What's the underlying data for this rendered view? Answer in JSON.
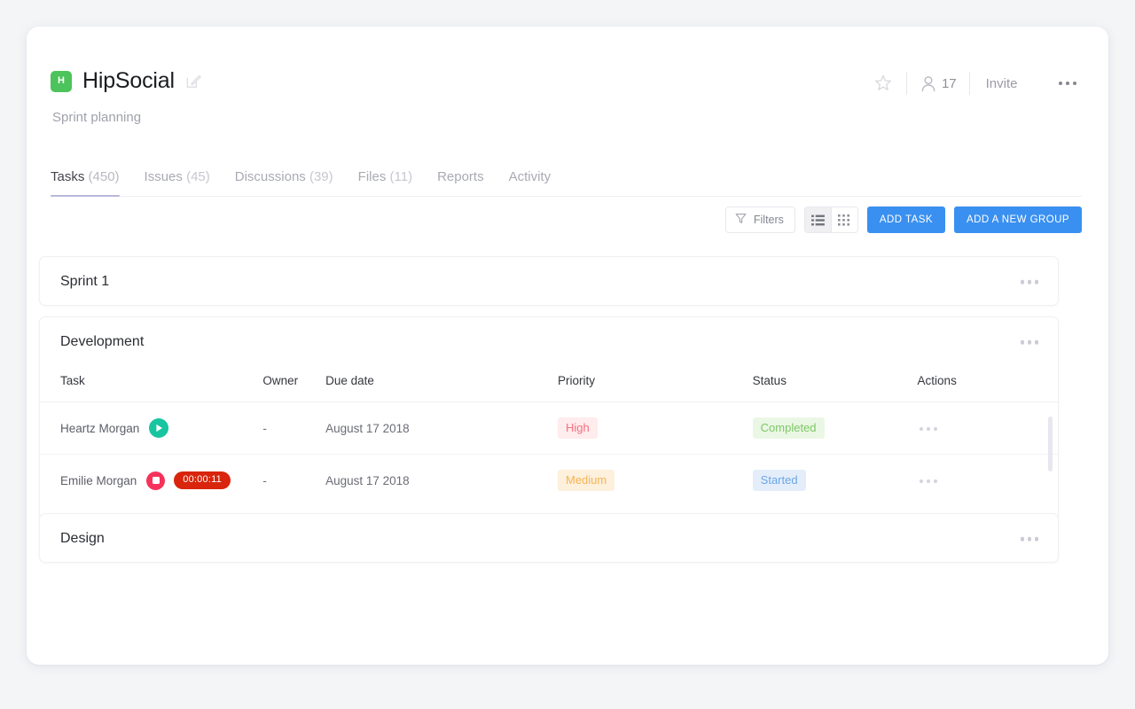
{
  "project": {
    "badge_letter": "H",
    "badge_color": "#4cc35b",
    "title": "HipSocial",
    "subtitle": "Sprint planning",
    "edit_icon": "edit-pencil-icon"
  },
  "header_actions": {
    "favorite_icon": "star-icon",
    "members_icon": "person-icon",
    "members_count": "17",
    "invite_label": "Invite",
    "overflow_icon": "more-horizontal-icon"
  },
  "tabs": [
    {
      "label": "Tasks",
      "count": "(450)",
      "active": true
    },
    {
      "label": "Issues",
      "count": "(45)",
      "active": false
    },
    {
      "label": "Discussions",
      "count": "(39)",
      "active": false
    },
    {
      "label": "Files",
      "count": "(11)",
      "active": false
    },
    {
      "label": "Reports",
      "count": "",
      "active": false
    },
    {
      "label": "Activity",
      "count": "",
      "active": false
    }
  ],
  "toolbar": {
    "filters_label": "Filters",
    "filters_icon": "funnel-icon",
    "list_view_icon": "list-view-icon",
    "grid_view_icon": "grid-view-icon",
    "active_view": "list",
    "add_task_label": "ADD TASK",
    "add_group_label": "ADD A NEW GROUP",
    "primary_color": "#3a90f0"
  },
  "groups": [
    {
      "title": "Sprint 1"
    },
    {
      "title": "Development"
    },
    {
      "title": "Design"
    }
  ],
  "table": {
    "columns": [
      "Task",
      "Owner",
      "Due date",
      "Priority",
      "Status",
      "Actions"
    ],
    "rows": [
      {
        "task": "Heartz Morgan",
        "timer_state": "play",
        "timer_value": "",
        "owner": "-",
        "due_date": "August 17 2018",
        "priority": "High",
        "priority_style": "high",
        "status": "Completed",
        "status_style": "completed"
      },
      {
        "task": "Emilie Morgan",
        "timer_state": "stop",
        "timer_value": "00:00:11",
        "owner": "-",
        "due_date": "August 17 2018",
        "priority": "Medium",
        "priority_style": "medium",
        "status": "Started",
        "status_style": "started"
      }
    ]
  },
  "colors": {
    "page_background": "#f4f5f7",
    "accent_blue": "#3a90f0",
    "tab_underline": "#b9b7dc",
    "play_green": "#17c5a0",
    "stop_red": "#f6325c",
    "timer_red": "#d8250b"
  }
}
